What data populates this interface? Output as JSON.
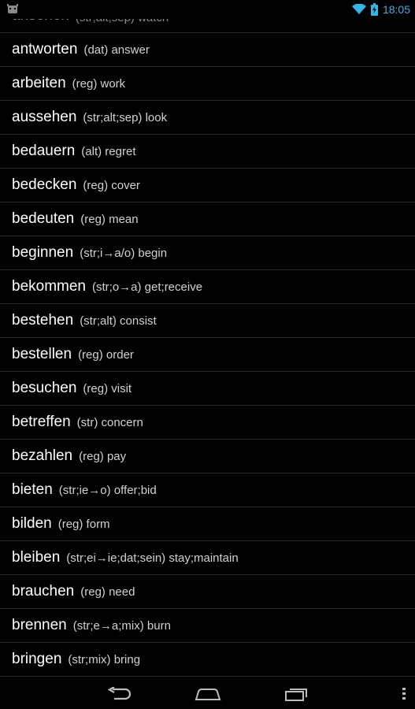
{
  "status_bar": {
    "time": "18:05",
    "icons": [
      "android-icon",
      "wifi-icon",
      "battery-charging-icon"
    ]
  },
  "verbs": [
    {
      "verb": "ansehen",
      "meta": "(str;alt;sep) watch"
    },
    {
      "verb": "antworten",
      "meta": "(dat) answer"
    },
    {
      "verb": "arbeiten",
      "meta": "(reg) work"
    },
    {
      "verb": "aussehen",
      "meta": "(str;alt;sep) look"
    },
    {
      "verb": "bedauern",
      "meta": "(alt) regret"
    },
    {
      "verb": "bedecken",
      "meta": "(reg) cover"
    },
    {
      "verb": "bedeuten",
      "meta": "(reg) mean"
    },
    {
      "verb": "beginnen",
      "meta": "(str;i→a/o) begin"
    },
    {
      "verb": "bekommen",
      "meta": "(str;o→a) get;receive"
    },
    {
      "verb": "bestehen",
      "meta": "(str;alt) consist"
    },
    {
      "verb": "bestellen",
      "meta": "(reg) order"
    },
    {
      "verb": "besuchen",
      "meta": "(reg) visit"
    },
    {
      "verb": "betreffen",
      "meta": "(str) concern"
    },
    {
      "verb": "bezahlen",
      "meta": "(reg) pay"
    },
    {
      "verb": "bieten",
      "meta": "(str;ie→o) offer;bid"
    },
    {
      "verb": "bilden",
      "meta": "(reg) form"
    },
    {
      "verb": "bleiben",
      "meta": "(str;ei→ie;dat;sein) stay;maintain"
    },
    {
      "verb": "brauchen",
      "meta": "(reg) need"
    },
    {
      "verb": "brennen",
      "meta": "(str;e→a;mix) burn"
    },
    {
      "verb": "bringen",
      "meta": "(str;mix) bring"
    }
  ],
  "nav_bar": {
    "icons": [
      "back-icon",
      "home-icon",
      "recent-apps-icon",
      "overflow-menu-icon"
    ]
  }
}
